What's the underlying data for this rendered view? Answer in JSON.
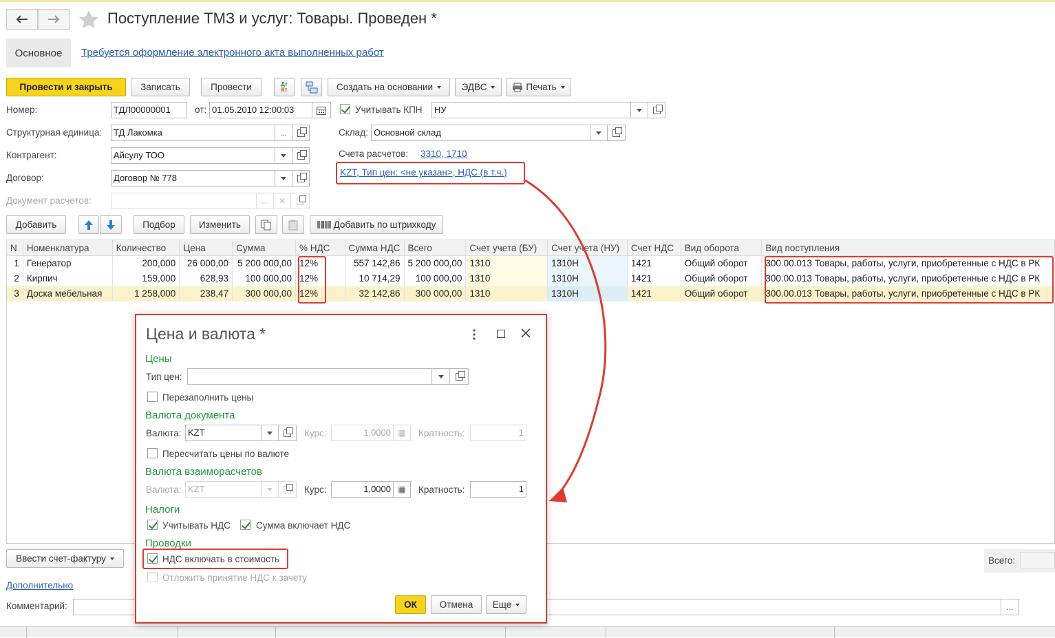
{
  "window": {
    "title": "Поступление ТМЗ и услуг: Товары. Проведен *",
    "tab_basic": "Основное",
    "notice_link": "Требуется оформление электронного акта выполненных работ"
  },
  "toolbar": {
    "post_close": "Провести и закрыть",
    "save": "Записать",
    "post": "Провести",
    "dtkt_icon": "Дт\nКт",
    "create_based": "Создать на основании",
    "edvs": "ЭДВС",
    "print": "Печать"
  },
  "header": {
    "number_label": "Номер:",
    "number_value": "ТДЛ00000001",
    "date_label": "от:",
    "date_value": "01.05.2010 12:00:03",
    "kpn_label": "Учитывать КПН",
    "kpn_value": "НУ",
    "unit_label": "Структурная единица:",
    "unit_value": "ТД Лакомка",
    "warehouse_label": "Склад:",
    "warehouse_value": "Основной склад",
    "counterparty_label": "Контрагент:",
    "counterparty_value": "Айсулу ТОО",
    "accounts_label": "Счета расчетов:",
    "accounts_value": "3310, 1710",
    "contract_label": "Договор:",
    "contract_value": "Договор № 778",
    "price_link": "KZT, Тип цен: <не указан>, НДС (в т.ч.)",
    "settlement_doc_label": "Документ расчетов:"
  },
  "table_toolbar": {
    "add": "Добавить",
    "selection": "Подбор",
    "change": "Изменить",
    "add_barcode": "Добавить по штрихкоду"
  },
  "table": {
    "columns": [
      "N",
      "Номенклатура",
      "Количество",
      "Цена",
      "Сумма",
      "% НДС",
      "Сумма НДС",
      "Всего",
      "Счет учета (БУ)",
      "Счет учета (НУ)",
      "Счет НДС",
      "Вид оборота",
      "Вид поступления"
    ],
    "rows": [
      [
        "1",
        "Генератор",
        "200,000",
        "26 000,00",
        "5 200 000,00",
        "12%",
        "557 142,86",
        "5 200 000,00",
        "1310",
        "1310Н",
        "1421",
        "Общий оборот",
        "300.00.013 Товары, работы, услуги, приобретенные с НДС в РК"
      ],
      [
        "2",
        "Кирпич",
        "159,000",
        "628,93",
        "100 000,00",
        "12%",
        "10 714,29",
        "100 000,00",
        "1310",
        "1310Н",
        "1421",
        "Общий оборот",
        "300.00.013 Товары, работы, услуги, приобретенные с НДС в РК"
      ],
      [
        "3",
        "Доска мебельная",
        "1 258,000",
        "238,47",
        "300 000,00",
        "12%",
        "32 142,86",
        "300 000,00",
        "1310",
        "1310Н",
        "1421",
        "Общий оборот",
        "300.00.013 Товары, работы, услуги, приобретенные с НДС в РК"
      ]
    ]
  },
  "footer": {
    "invoice_btn": "Ввести счет-фактуру",
    "total_label": "Всего:",
    "more_link": "Дополнительно",
    "comment_label": "Комментарий:",
    "comment_btn": "..."
  },
  "dialog": {
    "title": "Цена и валюта *",
    "prices_section": "Цены",
    "price_type_label": "Тип цен:",
    "price_type_value": "",
    "refill_prices": "Перезаполнить цены",
    "doc_currency_section": "Валюта документа",
    "currency_label": "Валюта:",
    "currency_value": "KZT",
    "rate_label": "Курс:",
    "rate_value": "1,0000",
    "multiplicity_label": "Кратность:",
    "multiplicity_value": "1",
    "recalc_prices": "Пересчитать цены по валюте",
    "settle_currency_section": "Валюта взаиморасчетов",
    "settle_currency_label": "Валюта:",
    "settle_currency_value": "KZT",
    "settle_rate_label": "Курс:",
    "settle_rate_value": "1,0000",
    "settle_multiplicity_label": "Кратность:",
    "settle_multiplicity_value": "1",
    "taxes_section": "Налоги",
    "consider_vat": "Учитывать НДС",
    "sum_includes_vat": "Сумма включает НДС",
    "postings_section": "Проводки",
    "vat_in_cost": "НДС включать в стоимость",
    "defer_vat": "Отложить принятие НДС к зачету",
    "ok": "ОК",
    "cancel": "Отмена",
    "more": "Еще"
  },
  "colors": {
    "primary_button": "#f6d41e",
    "section_green": "#1f9a3d",
    "link_blue": "#2b5eb5",
    "highlight_red": "#e03a2e"
  }
}
